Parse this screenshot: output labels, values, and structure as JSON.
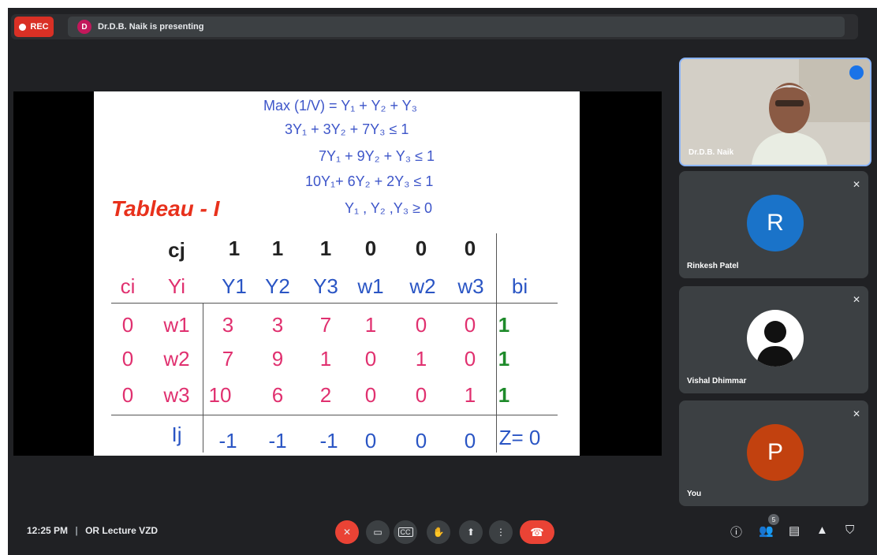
{
  "topbar": {
    "rec_label": "REC",
    "presenter_initial": "D",
    "presenter_text": "Dr.D.B. Naik is presenting"
  },
  "slide": {
    "equations": [
      "Max (1/V) = Y₁ + Y₂ + Y₃",
      "3Y₁ + 3Y₂ + 7Y₃ ≤ 1",
      "7Y₁ + 9Y₂ + Y₃ ≤ 1",
      "10Y₁+ 6Y₂ + 2Y₃ ≤ 1",
      "Y₁ , Y₂ ,Y₃ ≥ 0"
    ],
    "tableau_title": "Tableau - I",
    "cj_label": "cj",
    "cj_values": [
      "1",
      "1",
      "1",
      "0",
      "0",
      "0"
    ],
    "ci_label": "ci",
    "yi_label": "Yi",
    "columns": [
      "Y1",
      "Y2",
      "Y3",
      "w1",
      "w2",
      "w3"
    ],
    "bi_label": "bi",
    "rows": [
      {
        "ci": "0",
        "basis": "w1",
        "values": [
          "3",
          "3",
          "7",
          "1",
          "0",
          "0"
        ],
        "b": "1"
      },
      {
        "ci": "0",
        "basis": "w2",
        "values": [
          "7",
          "9",
          "1",
          "0",
          "1",
          "0"
        ],
        "b": "1"
      },
      {
        "ci": "0",
        "basis": "w3",
        "values": [
          "10",
          "6",
          "2",
          "0",
          "0",
          "1"
        ],
        "b": "1"
      }
    ],
    "ij_label": "Ij",
    "ij_values": [
      "-1",
      "-1",
      "-1",
      "0",
      "0",
      "0"
    ],
    "z_value": "Z= 0"
  },
  "participants": [
    {
      "name": "Dr.D.B. Naik",
      "initial": "",
      "color": "",
      "video": true
    },
    {
      "name": "Rinkesh Patel",
      "initial": "R",
      "color": "#1a73c9"
    },
    {
      "name": "Vishal Dhimmar",
      "initial": "",
      "color": "#ffffff"
    },
    {
      "name": "You",
      "initial": "P",
      "color": "#c2410f"
    }
  ],
  "bottom": {
    "time": "12:25 PM",
    "separator": "|",
    "meeting_name": "OR Lecture VZD",
    "people_count": "5"
  }
}
